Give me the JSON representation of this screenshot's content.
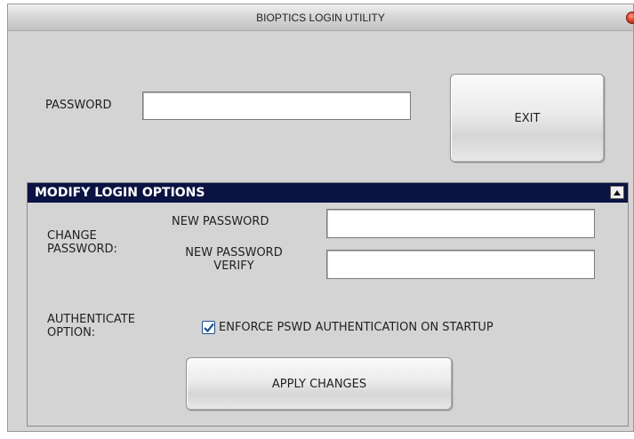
{
  "window": {
    "title": "BIOPTICS LOGIN UTILITY"
  },
  "login": {
    "password_label": "PASSWORD",
    "password_value": "",
    "exit_label": "EXIT"
  },
  "options": {
    "header": "MODIFY LOGIN OPTIONS",
    "change_password_label": "CHANGE\nPASSWORD:",
    "new_password_label": "NEW PASSWORD",
    "new_password_value": "",
    "new_password_verify_label": "NEW PASSWORD\nVERIFY",
    "new_password_verify_value": "",
    "authenticate_label": "AUTHENTICATE\nOPTION:",
    "enforce_checkbox_label": "ENFORCE PSWD AUTHENTICATION ON STARTUP",
    "enforce_checked": true,
    "apply_label": "APPLY CHANGES"
  },
  "colors": {
    "header_bg": "#0b1343",
    "window_bg": "#d4d4d4",
    "check_color": "#1c4f8f"
  },
  "icons": {
    "close": "close-icon",
    "collapse": "collapse-up-icon",
    "check": "checkmark-icon"
  }
}
